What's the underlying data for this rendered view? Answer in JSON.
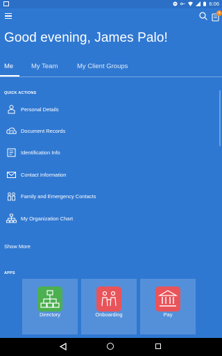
{
  "status_bar": {
    "time": "6:06"
  },
  "greeting": "Good evening, James Palo!",
  "tabs": [
    {
      "label": "Me"
    },
    {
      "label": "My Team"
    },
    {
      "label": "My Client Groups"
    }
  ],
  "notifications": {
    "count": "4"
  },
  "quick_actions": {
    "title": "QUICK ACTIONS",
    "items": [
      {
        "label": "Personal Details",
        "icon": "person-icon"
      },
      {
        "label": "Document Records",
        "icon": "cloud-documents-icon"
      },
      {
        "label": "Identification Info",
        "icon": "id-card-icon"
      },
      {
        "label": "Contact Information",
        "icon": "envelope-icon"
      },
      {
        "label": "Family and Emergency Contacts",
        "icon": "family-icon"
      },
      {
        "label": "My Organization Chart",
        "icon": "org-chart-icon"
      }
    ],
    "show_more": "Show More"
  },
  "apps": {
    "title": "APPS",
    "items": [
      {
        "label": "Directory",
        "icon": "directory-icon",
        "color": "#4caf50"
      },
      {
        "label": "Onboarding",
        "icon": "onboarding-icon",
        "color": "#e8545a"
      },
      {
        "label": "Pay",
        "icon": "bank-icon",
        "color": "#e8545a"
      }
    ]
  },
  "colors": {
    "background": "#2f78d2",
    "status_bar": "#2b6fc6",
    "badge": "#f28c28"
  }
}
